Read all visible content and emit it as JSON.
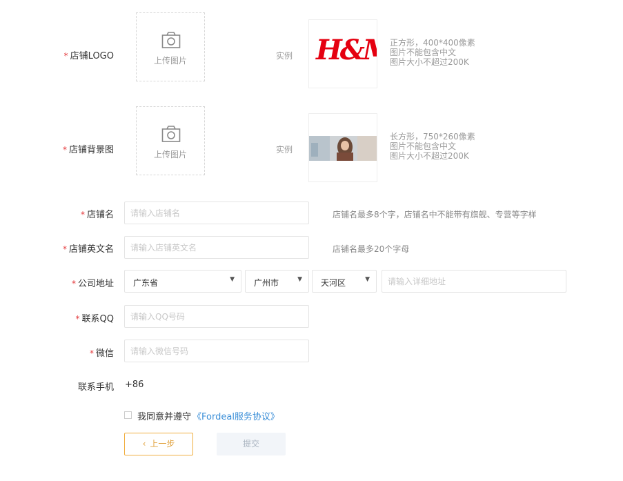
{
  "logo": {
    "label": "店铺LOGO",
    "upload_text": "上传图片",
    "example_label": "实例",
    "example_brand": "H&M",
    "specs": [
      "正方形，400*400像素",
      "图片不能包含中文",
      "图片大小不超过200K"
    ]
  },
  "background": {
    "label": "店铺背景图",
    "upload_text": "上传图片",
    "example_label": "实例",
    "specs": [
      "长方形，750*260像素",
      "图片不能包含中文",
      "图片大小不超过200K"
    ]
  },
  "store_name": {
    "label": "店铺名",
    "placeholder": "请输入店铺名",
    "hint": "店铺名最多8个字，店铺名中不能带有旗舰、专营等字样"
  },
  "store_english_name": {
    "label": "店铺英文名",
    "placeholder": "请输入店铺英文名",
    "hint": "店铺名最多20个字母"
  },
  "address": {
    "label": "公司地址",
    "province": "广东省",
    "city": "广州市",
    "district": "天河区",
    "detail_placeholder": "请输入详细地址"
  },
  "qq": {
    "label": "联系QQ",
    "placeholder": "请输入QQ号码"
  },
  "wechat": {
    "label": "微信",
    "placeholder": "请输入微信号码"
  },
  "phone": {
    "label": "联系手机",
    "prefix": "+86"
  },
  "agreement": {
    "text": "我同意并遵守",
    "link": "《Fordeal服务协议》"
  },
  "buttons": {
    "prev": "上一步",
    "prev_icon": "‹",
    "submit": "提交"
  },
  "required_mark": "*",
  "colors": {
    "required": "#e4393c",
    "accent": "#f0ad3e",
    "link": "#3b8fd8",
    "hm_red": "#e50010"
  }
}
